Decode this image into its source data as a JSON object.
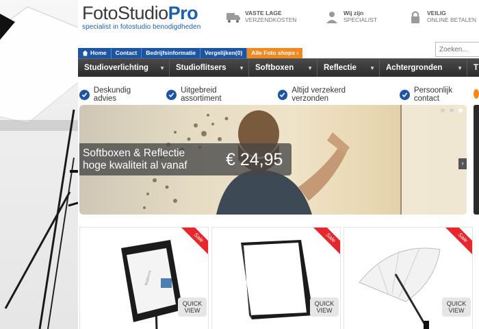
{
  "brand": {
    "name_main": "FotoStudio",
    "name_accent": "Pro",
    "tagline": "specialist in fotostudio benodigdheden"
  },
  "usps": [
    {
      "icon": "truck-icon",
      "line1": "VASTE LAGE",
      "line2": "VERZENDKOSTEN"
    },
    {
      "icon": "specialist-icon",
      "line1": "Wij zijn",
      "line2": "SPECIALIST"
    },
    {
      "icon": "lock-icon",
      "line1": "VEILIG",
      "line2": "ONLINE BETALEN"
    }
  ],
  "search": {
    "placeholder": "Zoeken..."
  },
  "topnav": [
    {
      "label": "Home",
      "icon": "home-icon"
    },
    {
      "label": "Contact"
    },
    {
      "label": "Bedrijfsinformatie"
    },
    {
      "label": "Vergelijken(0)"
    },
    {
      "label": "Alle Foto shops ›",
      "accent": "#f08a20"
    }
  ],
  "categories": [
    {
      "label": "Studioverlichting"
    },
    {
      "label": "Studioflitsers"
    },
    {
      "label": "Softboxen"
    },
    {
      "label": "Reflectie"
    },
    {
      "label": "Achtergronden"
    },
    {
      "label": "T"
    }
  ],
  "checks": [
    {
      "label": "Deskundig advies"
    },
    {
      "label": "Uitgebreid assortiment"
    },
    {
      "label": "Altijd verzekerd verzonden"
    },
    {
      "label": "Persoonlijk contact"
    }
  ],
  "hero": {
    "line1": "Softboxen & Reflectie",
    "line2": "hoge kwaliteit al vanaf",
    "price": "€ 24,95",
    "slides": 3,
    "active_slide": 3
  },
  "products": [
    {
      "badge": "Sale",
      "quick_view": [
        "QUICK",
        "VIEW"
      ],
      "image": "softbox-on-stand"
    },
    {
      "badge": "Sale",
      "quick_view": [
        "QUICK",
        "VIEW"
      ],
      "image": "square-softbox"
    },
    {
      "badge": "Sale",
      "quick_view": [
        "QUICK",
        "VIEW"
      ],
      "image": "white-umbrella"
    }
  ],
  "colors": {
    "brand_blue": "#1d55a6",
    "accent_orange": "#f08a20",
    "nav_dark": "#2c2c2c",
    "sale_red": "#e8262b"
  }
}
